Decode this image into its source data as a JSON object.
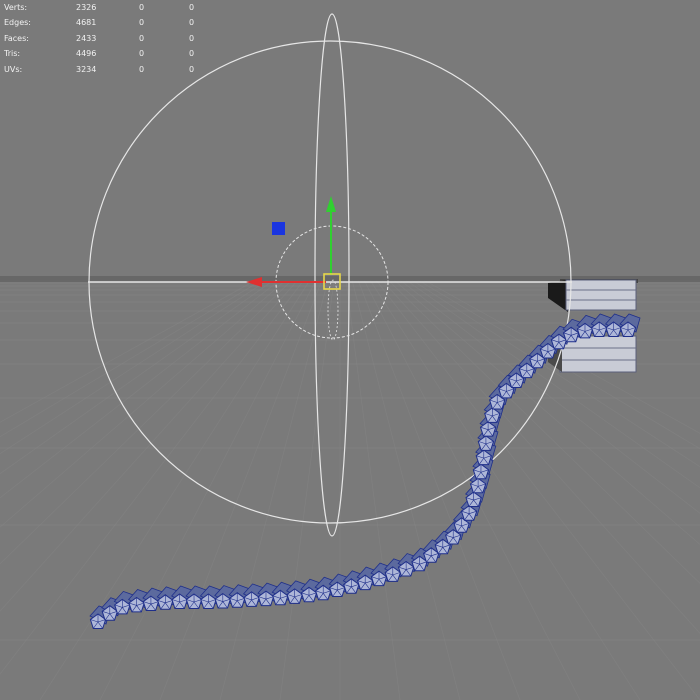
{
  "stats": [
    {
      "label": "Verts:",
      "values": [
        "2326",
        "0",
        "0"
      ]
    },
    {
      "label": "Edges:",
      "values": [
        "4681",
        "0",
        "0"
      ]
    },
    {
      "label": "Faces:",
      "values": [
        "2433",
        "0",
        "0"
      ]
    },
    {
      "label": "Tris:",
      "values": [
        "4496",
        "0",
        "0"
      ]
    },
    {
      "label": "UVs:",
      "values": [
        "3234",
        "0",
        "0"
      ]
    }
  ],
  "colors": {
    "background": "#7a7a7a",
    "grid": "#888888",
    "horizon": "#5c5c5c",
    "manipulator_ring": "#e6e6e6",
    "x_axis": "#e03030",
    "y_axis": "#30d030",
    "center_handle": "#e8d84a",
    "plane_handle": "#1a35e0",
    "mesh_wire": "#1f2f8a",
    "mesh_fill": "#aeb7d8",
    "block_face": "#c9ccd6"
  },
  "icons": {
    "manipulator": "rotate-move-manipulator-icon",
    "x_axis": "x-axis-arrow-icon",
    "y_axis": "y-axis-arrow-icon",
    "plane_handle": "plane-handle-square-icon",
    "center_handle": "center-handle-icon"
  }
}
